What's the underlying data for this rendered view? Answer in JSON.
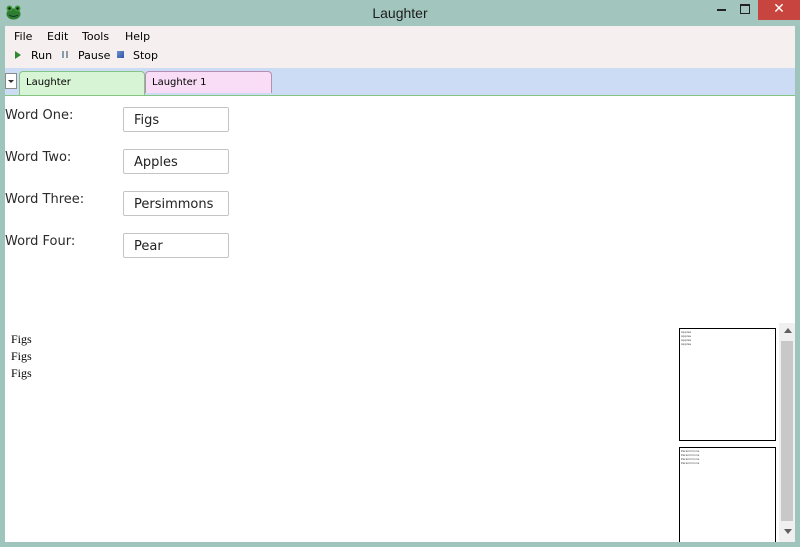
{
  "window": {
    "title": "Laughter"
  },
  "colors": {
    "frame": "#a2c6bd",
    "close": "#c7453e",
    "menubar": "#f6eff0",
    "tabstrip": "#cddcf5",
    "tab_active": "#d7f4d4",
    "tab_inactive": "#f9ddf6"
  },
  "menu": {
    "items": [
      "File",
      "Edit",
      "Tools",
      "Help"
    ]
  },
  "toolbar": {
    "run": "Run",
    "pause": "Pause",
    "stop": "Stop"
  },
  "tabs": [
    {
      "label": "Laughter",
      "active": true
    },
    {
      "label": "Laughter 1",
      "active": false
    }
  ],
  "form": {
    "fields": [
      {
        "label": "Word One:",
        "value": "Figs"
      },
      {
        "label": "Word Two:",
        "value": "Apples"
      },
      {
        "label": "Word Three:",
        "value": "Persimmons"
      },
      {
        "label": "Word Four:",
        "value": "Pear"
      }
    ]
  },
  "output": {
    "lines": [
      "Figs",
      "Figs",
      "Figs"
    ]
  },
  "thumbnails": [
    {
      "lines": [
        "Apples",
        "Apples",
        "Apples",
        "Apples"
      ]
    },
    {
      "lines": [
        "Persimmons",
        "Persimmons",
        "Persimmons",
        "Persimmons"
      ]
    }
  ],
  "icons": {
    "app": "frog-icon",
    "minimize": "minimize-icon",
    "maximize": "maximize-icon",
    "close": "close-icon",
    "run": "play-icon",
    "pause": "pause-icon",
    "stop": "stop-icon"
  }
}
